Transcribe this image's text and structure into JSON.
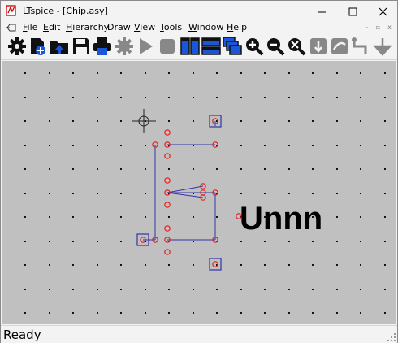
{
  "window": {
    "title": "LTspice - [Chip.asy]",
    "controls": [
      "minimize",
      "maximize",
      "close"
    ]
  },
  "menu": {
    "items": [
      {
        "label": "File",
        "accel": "F",
        "rest": "ile"
      },
      {
        "label": "Edit",
        "accel": "E",
        "rest": "dit"
      },
      {
        "label": "Hierarchy",
        "accel": "H",
        "rest": "ierarchy"
      },
      {
        "label": "Draw",
        "accel": "",
        "rest": "Draw"
      },
      {
        "label": "View",
        "accel": "V",
        "rest": "iew"
      },
      {
        "label": "Tools",
        "accel": "T",
        "rest": "ools"
      },
      {
        "label": "Window",
        "accel": "W",
        "rest": "indow"
      },
      {
        "label": "Help",
        "accel": "H",
        "rest": "elp"
      }
    ],
    "mdi_controls": [
      "-",
      "▫",
      "x"
    ]
  },
  "toolbar": {
    "buttons": [
      {
        "icon": "gear-icon",
        "enabled": true
      },
      {
        "icon": "new-file-icon",
        "enabled": true
      },
      {
        "icon": "open-folder-icon",
        "enabled": true
      },
      {
        "icon": "save-icon",
        "enabled": true
      },
      {
        "icon": "print-icon",
        "enabled": true
      },
      {
        "icon": "component-gear-icon",
        "enabled": false
      },
      {
        "icon": "run-icon",
        "enabled": false
      },
      {
        "icon": "stop-icon",
        "enabled": false
      },
      {
        "icon": "tile-vertical-icon",
        "enabled": true
      },
      {
        "icon": "tile-horizontal-icon",
        "enabled": true
      },
      {
        "icon": "cascade-icon",
        "enabled": true
      },
      {
        "icon": "zoom-in-icon",
        "enabled": true
      },
      {
        "icon": "zoom-out-icon",
        "enabled": true
      },
      {
        "icon": "zoom-fit-icon",
        "enabled": true
      },
      {
        "icon": "move-icon",
        "enabled": false
      },
      {
        "icon": "drag-icon",
        "enabled": false
      },
      {
        "icon": "wire-icon",
        "enabled": false
      },
      {
        "icon": "ground-icon",
        "enabled": false
      }
    ]
  },
  "canvas": {
    "background": "#c0c0c0",
    "line_color": "#3333aa",
    "handle_color": "#e02020",
    "pin_color": "#3333aa",
    "symbol_text": "Unnn"
  },
  "status": {
    "text": "Ready"
  }
}
